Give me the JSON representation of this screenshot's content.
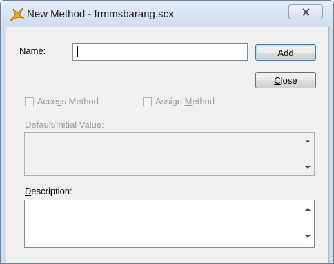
{
  "window": {
    "title": "New Method - frmmsbarang.scx",
    "close_glyph": "✕",
    "app_icon": "foxpro-icon"
  },
  "form": {
    "name_label_prefix": "N",
    "name_label_rest": "ame:",
    "name_value": "",
    "add_prefix": "A",
    "add_rest": "dd",
    "close_prefix": "C",
    "close_rest": "lose",
    "access_pre": "Acce",
    "access_ul": "s",
    "access_post": "s Method",
    "assign_pre": "Assign ",
    "assign_ul": "M",
    "assign_post": "ethod",
    "default_pre": "Default",
    "default_ul": "/",
    "default_post": "Initial Value:",
    "description_prefix": "D",
    "description_rest": "escription:",
    "default_value": "",
    "description_value": ""
  },
  "colors": {
    "title_bar": "#cfdded",
    "client": "#f0f0f0",
    "disabled_text": "#9a9a9a",
    "default_button_border": "#3c7fb1"
  }
}
